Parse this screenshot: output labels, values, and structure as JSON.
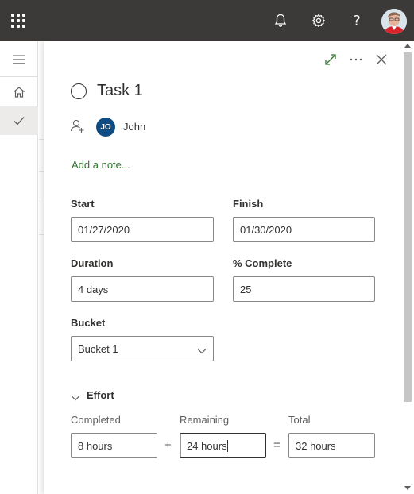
{
  "topbar": {
    "app_launcher_icon": "waffle-icon",
    "notifications_icon": "bell-icon",
    "settings_icon": "gear-icon",
    "help_label": "?",
    "avatar_icon": "user-photo"
  },
  "rail": {
    "items": [
      {
        "icon": "hamburger-icon"
      },
      {
        "icon": "home-icon"
      },
      {
        "icon": "checkmark-icon",
        "active": true
      }
    ]
  },
  "panel": {
    "expand_icon": "expand-icon",
    "more_icon": "more-icon",
    "close_icon": "close-icon",
    "title": "Task 1",
    "assignee": {
      "initials": "JO",
      "name": "John",
      "color": "#0f4c81"
    },
    "add_note": "Add a note...",
    "start": {
      "label": "Start",
      "value": "01/27/2020"
    },
    "finish": {
      "label": "Finish",
      "value": "01/30/2020"
    },
    "duration": {
      "label": "Duration",
      "value": "4 days"
    },
    "percent": {
      "label": "% Complete",
      "value": "25"
    },
    "bucket": {
      "label": "Bucket",
      "value": "Bucket 1"
    },
    "effort": {
      "label": "Effort",
      "completed": {
        "label": "Completed",
        "value": "8 hours"
      },
      "remaining": {
        "label": "Remaining",
        "value": "24 hours"
      },
      "total": {
        "label": "Total",
        "value": "32 hours"
      },
      "plus": "+",
      "equals": "="
    }
  },
  "colors": {
    "topbar": "#3b3a39",
    "accent_green": "#31752f",
    "avatar_blue": "#0f4c81",
    "scrollbar_accent": "#c8c6c4"
  }
}
